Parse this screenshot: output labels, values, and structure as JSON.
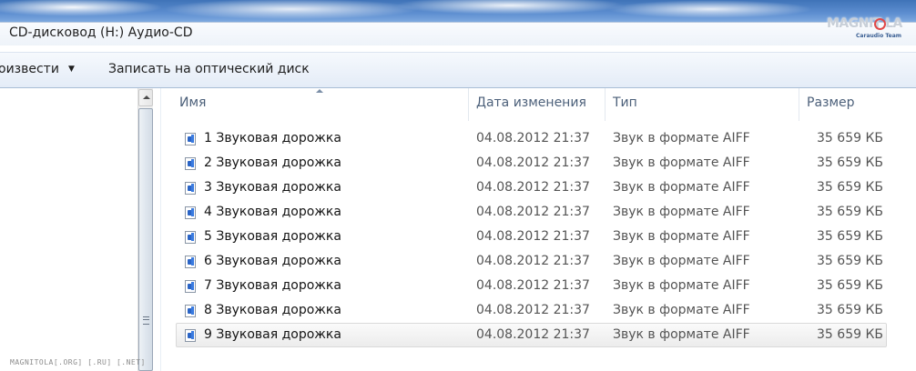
{
  "window": {
    "title": "CD-дисковод (H:) Аудио-CD"
  },
  "logo": {
    "brand": "MAGNIT LA",
    "subtitle": "Caraudio Team"
  },
  "toolbar": {
    "play_label": "оизвести",
    "play_caret": "▼",
    "burn_label": "Записать на оптический диск"
  },
  "columns": {
    "name": "Имя",
    "date": "Дата изменения",
    "type": "Тип",
    "size": "Размер"
  },
  "files": [
    {
      "name": "1 Звуковая дорожка",
      "date": "04.08.2012 21:37",
      "type": "Звук в формате AIFF",
      "size": "35 659 КБ"
    },
    {
      "name": "2 Звуковая дорожка",
      "date": "04.08.2012 21:37",
      "type": "Звук в формате AIFF",
      "size": "35 659 КБ"
    },
    {
      "name": "3 Звуковая дорожка",
      "date": "04.08.2012 21:37",
      "type": "Звук в формате AIFF",
      "size": "35 659 КБ"
    },
    {
      "name": "4 Звуковая дорожка",
      "date": "04.08.2012 21:37",
      "type": "Звук в формате AIFF",
      "size": "35 659 КБ"
    },
    {
      "name": "5 Звуковая дорожка",
      "date": "04.08.2012 21:37",
      "type": "Звук в формате AIFF",
      "size": "35 659 КБ"
    },
    {
      "name": "6 Звуковая дорожка",
      "date": "04.08.2012 21:37",
      "type": "Звук в формате AIFF",
      "size": "35 659 КБ"
    },
    {
      "name": "7 Звуковая дорожка",
      "date": "04.08.2012 21:37",
      "type": "Звук в формате AIFF",
      "size": "35 659 КБ"
    },
    {
      "name": "8 Звуковая дорожка",
      "date": "04.08.2012 21:37",
      "type": "Звук в формате AIFF",
      "size": "35 659 КБ"
    },
    {
      "name": "9 Звуковая дорожка",
      "date": "04.08.2012 21:37",
      "type": "Звук в формате AIFF",
      "size": "35 659 КБ"
    }
  ],
  "selected_index": 8,
  "icons": {
    "file": "audio-file-icon",
    "sort": "sort-ascending-icon",
    "scroll_up": "scroll-up-arrow-icon",
    "grip": "scrollbar-grip-icon"
  },
  "watermark": "MAGNITOLA[.ORG] [.RU] [.NET]"
}
